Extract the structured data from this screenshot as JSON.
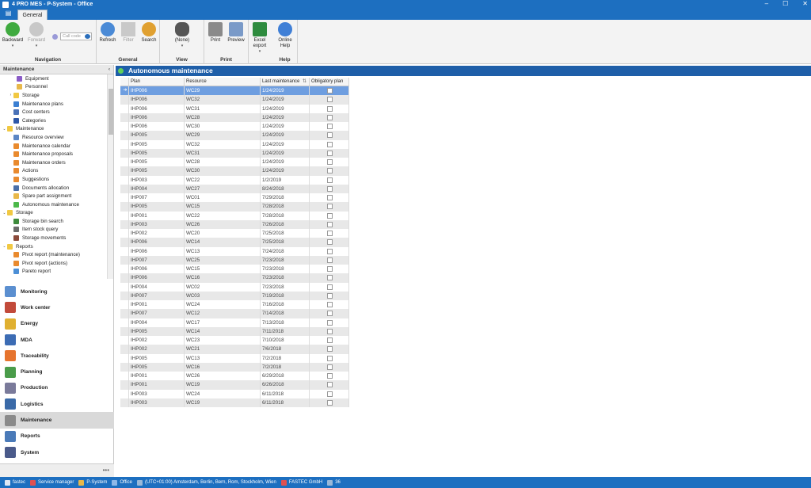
{
  "window": {
    "title": "4 PRO MES - P-System - Office",
    "min": "–",
    "max": "☐",
    "close": "✕"
  },
  "ribbon": {
    "appmenu": "▤",
    "tab": "General",
    "groups": [
      {
        "label": "Navigation",
        "buttons": [
          "Backward",
          "Forward"
        ]
      },
      {
        "label": "General",
        "buttons": [
          "Refresh",
          "Filter",
          "Search"
        ]
      },
      {
        "label": "View",
        "buttons": [
          "(None)"
        ]
      },
      {
        "label": "Print",
        "buttons": [
          "Print",
          "Preview"
        ]
      },
      {
        "label": "",
        "buttons": [
          "Excel export"
        ]
      },
      {
        "label": "Help",
        "buttons": [
          "Online Help"
        ]
      }
    ],
    "search_placeholder": "Call code",
    "caret": "▾"
  },
  "left": {
    "header": "Maintenance",
    "collapse": "‹",
    "tree": [
      {
        "label": "Equipment",
        "indent": 3,
        "exp": "",
        "color": "#8a5cc7"
      },
      {
        "label": "Personnel",
        "indent": 3,
        "exp": "",
        "color": "#e8b84a"
      },
      {
        "label": "Storage",
        "indent": 2,
        "exp": "›",
        "color": "#f1c842"
      },
      {
        "label": "Maintenance plans",
        "indent": 2,
        "exp": "",
        "color": "#3b7fd2"
      },
      {
        "label": "Cost centers",
        "indent": 2,
        "exp": "",
        "color": "#4a72b8"
      },
      {
        "label": "Categories",
        "indent": 2,
        "exp": "",
        "color": "#2d57a8"
      },
      {
        "label": "Maintenance",
        "indent": 0,
        "exp": "⌄",
        "color": "#f1c842"
      },
      {
        "label": "Resource overview",
        "indent": 2,
        "exp": "",
        "color": "#5b86c4"
      },
      {
        "label": "Maintenance calendar",
        "indent": 2,
        "exp": "",
        "color": "#e98a2e"
      },
      {
        "label": "Maintenance proposals",
        "indent": 2,
        "exp": "",
        "color": "#e98a2e"
      },
      {
        "label": "Maintenance orders",
        "indent": 2,
        "exp": "",
        "color": "#e98a2e"
      },
      {
        "label": "Actions",
        "indent": 2,
        "exp": "",
        "color": "#e98a2e"
      },
      {
        "label": "Suggestions",
        "indent": 2,
        "exp": "",
        "color": "#e98a2e"
      },
      {
        "label": "Documents allocation",
        "indent": 2,
        "exp": "",
        "color": "#4a6fa8"
      },
      {
        "label": "Spare part assignment",
        "indent": 2,
        "exp": "",
        "color": "#e8b84a"
      },
      {
        "label": "Autonomous maintenance",
        "indent": 2,
        "exp": "",
        "color": "#4cb84a"
      },
      {
        "label": "Storage",
        "indent": 0,
        "exp": "⌄",
        "color": "#f1c842"
      },
      {
        "label": "Storage bin search",
        "indent": 2,
        "exp": "",
        "color": "#3d8a3c"
      },
      {
        "label": "Item stock query",
        "indent": 2,
        "exp": "",
        "color": "#6b6b6b"
      },
      {
        "label": "Storage movements",
        "indent": 2,
        "exp": "",
        "color": "#8a4a3a"
      },
      {
        "label": "Reports",
        "indent": 0,
        "exp": "⌄",
        "color": "#f1c842"
      },
      {
        "label": "Pivot report (maintenance)",
        "indent": 2,
        "exp": "",
        "color": "#e98a2e"
      },
      {
        "label": "Pivot report (actions)",
        "indent": 2,
        "exp": "",
        "color": "#e98a2e"
      },
      {
        "label": "Pareto report",
        "indent": 2,
        "exp": "",
        "color": "#4c8fd6"
      }
    ],
    "nav": [
      {
        "label": "Monitoring",
        "color": "#5b8fd0"
      },
      {
        "label": "Work center",
        "color": "#c24a3a"
      },
      {
        "label": "Energy",
        "color": "#e0b030"
      },
      {
        "label": "MDA",
        "color": "#3c6cb4"
      },
      {
        "label": "Traceability",
        "color": "#e6742e"
      },
      {
        "label": "Planning",
        "color": "#4a9c4a"
      },
      {
        "label": "Production",
        "color": "#7a7a9a"
      },
      {
        "label": "Logistics",
        "color": "#3a6aa8"
      },
      {
        "label": "Maintenance",
        "color": "#8a8a8a"
      },
      {
        "label": "Reports",
        "color": "#4a7ab8"
      },
      {
        "label": "System",
        "color": "#4a5a8a"
      }
    ],
    "active_nav": "Maintenance",
    "more": "•••"
  },
  "content": {
    "title": "Autonomous maintenance",
    "columns": {
      "plan": "Plan",
      "resource": "Resource",
      "last": "Last maintenance",
      "obligatory": "Obligatory plan"
    },
    "sort_icon": "⇅",
    "current_row_arrow": "➔",
    "rows": [
      [
        "IHP006",
        "WC29",
        "1/24/2019"
      ],
      [
        "IHP006",
        "WC32",
        "1/24/2019"
      ],
      [
        "IHP006",
        "WC31",
        "1/24/2019"
      ],
      [
        "IHP006",
        "WC28",
        "1/24/2019"
      ],
      [
        "IHP006",
        "WC30",
        "1/24/2019"
      ],
      [
        "IHP005",
        "WC29",
        "1/24/2019"
      ],
      [
        "IHP005",
        "WC32",
        "1/24/2019"
      ],
      [
        "IHP005",
        "WC31",
        "1/24/2019"
      ],
      [
        "IHP005",
        "WC28",
        "1/24/2019"
      ],
      [
        "IHP005",
        "WC30",
        "1/24/2019"
      ],
      [
        "IHP003",
        "WC22",
        "1/2/2019"
      ],
      [
        "IHP004",
        "WC27",
        "8/24/2018"
      ],
      [
        "IHP007",
        "WC01",
        "7/29/2018"
      ],
      [
        "IHP005",
        "WC15",
        "7/28/2018"
      ],
      [
        "IHP001",
        "WC22",
        "7/28/2018"
      ],
      [
        "IHP003",
        "WC26",
        "7/26/2018"
      ],
      [
        "IHP002",
        "WC20",
        "7/25/2018"
      ],
      [
        "IHP006",
        "WC14",
        "7/25/2018"
      ],
      [
        "IHP006",
        "WC13",
        "7/24/2018"
      ],
      [
        "IHP007",
        "WC25",
        "7/23/2018"
      ],
      [
        "IHP006",
        "WC15",
        "7/23/2018"
      ],
      [
        "IHP006",
        "WC16",
        "7/23/2018"
      ],
      [
        "IHP004",
        "WC02",
        "7/23/2018"
      ],
      [
        "IHP007",
        "WC03",
        "7/19/2018"
      ],
      [
        "IHP001",
        "WC24",
        "7/16/2018"
      ],
      [
        "IHP007",
        "WC12",
        "7/14/2018"
      ],
      [
        "IHP004",
        "WC17",
        "7/13/2018"
      ],
      [
        "IHP005",
        "WC14",
        "7/11/2018"
      ],
      [
        "IHP002",
        "WC23",
        "7/10/2018"
      ],
      [
        "IHP002",
        "WC21",
        "7/6/2018"
      ],
      [
        "IHP005",
        "WC13",
        "7/2/2018"
      ],
      [
        "IHP005",
        "WC16",
        "7/2/2018"
      ],
      [
        "IHP001",
        "WC26",
        "6/29/2018"
      ],
      [
        "IHP001",
        "WC19",
        "6/26/2018"
      ],
      [
        "IHP003",
        "WC24",
        "6/11/2018"
      ],
      [
        "IHP003",
        "WC19",
        "6/11/2018"
      ]
    ],
    "selected_index": 0
  },
  "status": {
    "items": [
      {
        "label": "fastec",
        "color": "#dfe8f5"
      },
      {
        "label": "Service manager",
        "color": "#e05050"
      },
      {
        "label": "P-System",
        "color": "#e8b84a"
      },
      {
        "label": "Office",
        "color": "#8fb8e8"
      },
      {
        "label": "(UTC+01:00) Amsterdam, Berlin, Bern, Rom, Stockholm, Wien",
        "color": "#9ab8d8"
      },
      {
        "label": "FASTEC GmbH",
        "color": "#e05050"
      },
      {
        "label": "36",
        "color": "#9ab8d8"
      }
    ]
  }
}
